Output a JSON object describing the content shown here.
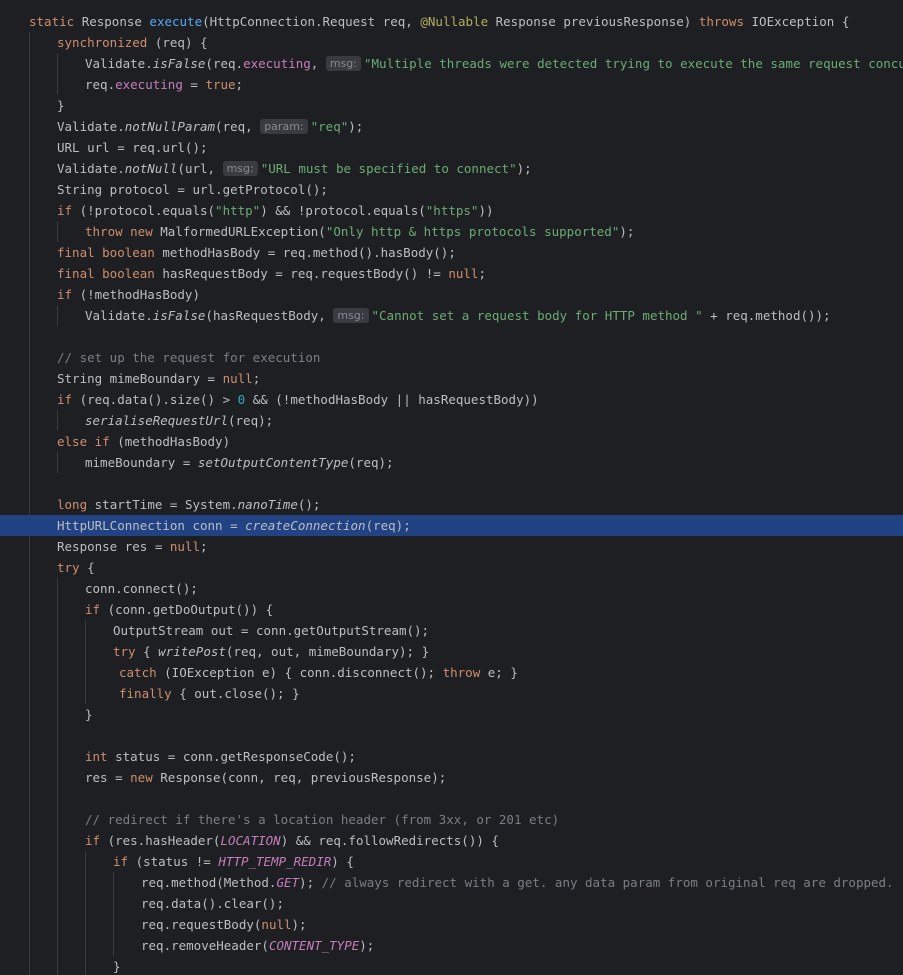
{
  "editor": {
    "highlight_line": 25,
    "lines": [
      [
        [
          "kw",
          "static "
        ],
        [
          "plain",
          "Response "
        ],
        [
          "fn",
          "execute"
        ],
        [
          "plain",
          "(HttpConnection.Request req, "
        ],
        [
          "ann",
          "@Nullable "
        ],
        [
          "plain",
          "Response previousResponse) "
        ],
        [
          "kw",
          "throws "
        ],
        [
          "plain",
          "IOException {"
        ]
      ],
      [
        [
          "kw",
          "synchronized "
        ],
        [
          "plain",
          "(req) {"
        ]
      ],
      [
        [
          "plain",
          "Validate."
        ],
        [
          "it",
          "isFalse"
        ],
        [
          "plain",
          "(req."
        ],
        [
          "fld",
          "executing"
        ],
        [
          "plain",
          ", "
        ],
        [
          "hint",
          "msg:"
        ],
        [
          "str",
          "\"Multiple threads were detected trying to execute the same request concurrently"
        ]
      ],
      [
        [
          "plain",
          "req."
        ],
        [
          "fld",
          "executing "
        ],
        [
          "plain",
          "= "
        ],
        [
          "kw",
          "true"
        ],
        [
          "plain",
          ";"
        ]
      ],
      [
        [
          "plain",
          "}"
        ]
      ],
      [
        [
          "plain",
          "Validate."
        ],
        [
          "it",
          "notNullParam"
        ],
        [
          "plain",
          "(req, "
        ],
        [
          "hint",
          "param:"
        ],
        [
          "str",
          "\"req\""
        ],
        [
          "plain",
          ");"
        ]
      ],
      [
        [
          "plain",
          "URL url = req.url();"
        ]
      ],
      [
        [
          "plain",
          "Validate."
        ],
        [
          "it",
          "notNull"
        ],
        [
          "plain",
          "(url, "
        ],
        [
          "hint",
          "msg:"
        ],
        [
          "str",
          "\"URL must be specified to connect\""
        ],
        [
          "plain",
          ");"
        ]
      ],
      [
        [
          "plain",
          "String protocol = url.getProtocol();"
        ]
      ],
      [
        [
          "kw",
          "if "
        ],
        [
          "plain",
          "(!protocol.equals("
        ],
        [
          "str",
          "\"http\""
        ],
        [
          "plain",
          ") && !protocol.equals("
        ],
        [
          "str",
          "\"https\""
        ],
        [
          "plain",
          "))"
        ]
      ],
      [
        [
          "kw",
          "throw new "
        ],
        [
          "plain",
          "MalformedURLException("
        ],
        [
          "str",
          "\"Only http & https protocols supported\""
        ],
        [
          "plain",
          ");"
        ]
      ],
      [
        [
          "kw",
          "final boolean "
        ],
        [
          "plain",
          "methodHasBody = req.method().hasBody();"
        ]
      ],
      [
        [
          "kw",
          "final boolean "
        ],
        [
          "plain",
          "hasRequestBody = req.requestBody() != "
        ],
        [
          "kw",
          "null"
        ],
        [
          "plain",
          ";"
        ]
      ],
      [
        [
          "kw",
          "if "
        ],
        [
          "plain",
          "(!methodHasBody)"
        ]
      ],
      [
        [
          "plain",
          "Validate."
        ],
        [
          "it",
          "isFalse"
        ],
        [
          "plain",
          "(hasRequestBody, "
        ],
        [
          "hint",
          "msg:"
        ],
        [
          "str",
          "\"Cannot set a request body for HTTP method \" "
        ],
        [
          "plain",
          "+ req.method());"
        ]
      ],
      [],
      [
        [
          "com",
          "// set up the request for execution"
        ]
      ],
      [
        [
          "plain",
          "String mimeBoundary = "
        ],
        [
          "kw",
          "null"
        ],
        [
          "plain",
          ";"
        ]
      ],
      [
        [
          "kw",
          "if "
        ],
        [
          "plain",
          "(req.data().size() > "
        ],
        [
          "num",
          "0 "
        ],
        [
          "plain",
          "&& (!methodHasBody || hasRequestBody))"
        ]
      ],
      [
        [
          "it",
          "serialiseRequestUrl"
        ],
        [
          "plain",
          "(req);"
        ]
      ],
      [
        [
          "kw",
          "else if "
        ],
        [
          "plain",
          "(methodHasBody)"
        ]
      ],
      [
        [
          "plain",
          "mimeBoundary = "
        ],
        [
          "it",
          "setOutputContentType"
        ],
        [
          "plain",
          "(req);"
        ]
      ],
      [],
      [
        [
          "kw",
          "long "
        ],
        [
          "plain",
          "startTime = System."
        ],
        [
          "it",
          "nanoTime"
        ],
        [
          "plain",
          "();"
        ]
      ],
      [
        [
          "plain",
          "HttpURLConnection conn = "
        ],
        [
          "it",
          "createConnection"
        ],
        [
          "plain",
          "(req);"
        ]
      ],
      [
        [
          "plain",
          "Response res = "
        ],
        [
          "kw",
          "null"
        ],
        [
          "plain",
          ";"
        ]
      ],
      [
        [
          "kw",
          "try "
        ],
        [
          "plain",
          "{"
        ]
      ],
      [
        [
          "plain",
          "conn.connect();"
        ]
      ],
      [
        [
          "kw",
          "if "
        ],
        [
          "plain",
          "(conn.getDoOutput()) {"
        ]
      ],
      [
        [
          "plain",
          "OutputStream out = conn.getOutputStream();"
        ]
      ],
      [
        [
          "kw",
          "try "
        ],
        [
          "plain",
          "{ "
        ],
        [
          "it",
          "writePost"
        ],
        [
          "plain",
          "(req, out, mimeBoundary); }"
        ]
      ],
      [
        [
          "kw",
          "catch "
        ],
        [
          "plain",
          "(IOException e) { conn.disconnect(); "
        ],
        [
          "kw",
          "throw "
        ],
        [
          "plain",
          "e; }"
        ]
      ],
      [
        [
          "kw",
          "finally "
        ],
        [
          "plain",
          "{ out.close(); }"
        ]
      ],
      [
        [
          "plain",
          "}"
        ]
      ],
      [],
      [
        [
          "kw",
          "int "
        ],
        [
          "plain",
          "status = conn.getResponseCode();"
        ]
      ],
      [
        [
          "plain",
          "res = "
        ],
        [
          "kw",
          "new "
        ],
        [
          "plain",
          "Response(conn, req, previousResponse);"
        ]
      ],
      [],
      [
        [
          "com",
          "// redirect if there's a location header (from 3xx, or 201 etc)"
        ]
      ],
      [
        [
          "kw",
          "if "
        ],
        [
          "plain",
          "(res.hasHeader("
        ],
        [
          "sf",
          "LOCATION"
        ],
        [
          "plain",
          ") && req.followRedirects()) {"
        ]
      ],
      [
        [
          "kw",
          "if "
        ],
        [
          "plain",
          "(status != "
        ],
        [
          "sf",
          "HTTP_TEMP_REDIR"
        ],
        [
          "plain",
          ") {"
        ]
      ],
      [
        [
          "plain",
          "req.method(Method."
        ],
        [
          "sf",
          "GET"
        ],
        [
          "plain",
          "); "
        ],
        [
          "com",
          "// always redirect with a get. any data param from original req are dropped."
        ]
      ],
      [
        [
          "plain",
          "req.data().clear();"
        ]
      ],
      [
        [
          "plain",
          "req.requestBody("
        ],
        [
          "kw",
          "null"
        ],
        [
          "plain",
          ");"
        ]
      ],
      [
        [
          "plain",
          "req.removeHeader("
        ],
        [
          "sf",
          "CONTENT_TYPE"
        ],
        [
          "plain",
          ");"
        ]
      ],
      [
        [
          "plain",
          "}"
        ]
      ]
    ]
  }
}
